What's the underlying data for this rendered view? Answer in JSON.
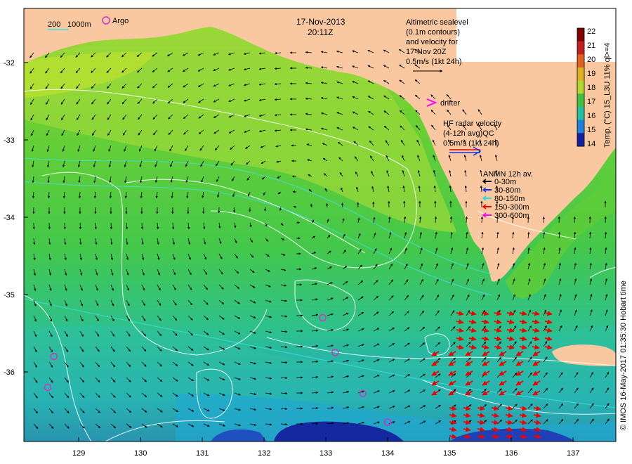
{
  "date": "17-Nov-2013",
  "time": "20:11Z",
  "scale": {
    "label_a": "200",
    "label_b": "1000m"
  },
  "argo_legend": {
    "label": "Argo",
    "color": "#cc33cc"
  },
  "altimetry": {
    "line1": "Altimetric sealevel",
    "line2": "(0.1m contours)",
    "line3": "and velocity for",
    "line4": "17-Nov 20Z",
    "line5": "0.5m/s (1kt 24h)"
  },
  "drifter": {
    "label": "drifter",
    "color": "#ff00ff"
  },
  "hf_radar": {
    "line1": "HF radar velocity",
    "line2": "(4-12h avg)QC",
    "line3": "0.5m/s (1kt 24h)",
    "color_a": "#ee0000",
    "color_b": "#1133ee"
  },
  "anmn": {
    "title": "ANMN 12h av.",
    "items": [
      {
        "label": "0-30m",
        "color": "#000000"
      },
      {
        "label": "30-80m",
        "color": "#1133ee"
      },
      {
        "label": "80-150m",
        "color": "#22dddd"
      },
      {
        "label": "150-300m",
        "color": "#ee0000"
      },
      {
        "label": "300-600m",
        "color": "#ff00ff"
      }
    ]
  },
  "colorbar": {
    "title": "Temp. (°C) 15_L3U 11% ql>=4",
    "ticks": [
      "22",
      "21",
      "20",
      "19",
      "18",
      "17",
      "16",
      "15",
      "14"
    ],
    "colors": [
      "#800000",
      "#c02020",
      "#e06020",
      "#e0b020",
      "#b0d830",
      "#40c040",
      "#20c0a0",
      "#2080e0",
      "#1020a0"
    ]
  },
  "credit": "© IMOS 16-May-2017 01:35:30 Hobart time",
  "axes": {
    "y_ticks": [
      "-32",
      "-33",
      "-34",
      "-35",
      "-36"
    ],
    "x_ticks": [
      "129",
      "130",
      "131",
      "132",
      "133",
      "134",
      "135",
      "136",
      "137"
    ]
  },
  "colors": {
    "land": "#f9c8a0",
    "ocean_green": "#5ccc3a",
    "ocean_lightgreen": "#8ed830",
    "ocean_yellow": "#b8e030",
    "ocean_teal": "#30c08a",
    "ocean_cyan": "#30b8c8",
    "ocean_deep": "#1830b0",
    "contour": "#ffffff",
    "isobath": "#40e0e0"
  },
  "argo_markers": [
    {
      "lon": 128.6,
      "lat": -35.8
    },
    {
      "lon": 128.5,
      "lat": -36.2
    },
    {
      "lon": 132.95,
      "lat": -35.3
    },
    {
      "lon": 133.15,
      "lat": -35.75
    },
    {
      "lon": 133.6,
      "lat": -36.28
    },
    {
      "lon": 134.0,
      "lat": -36.65
    }
  ]
}
